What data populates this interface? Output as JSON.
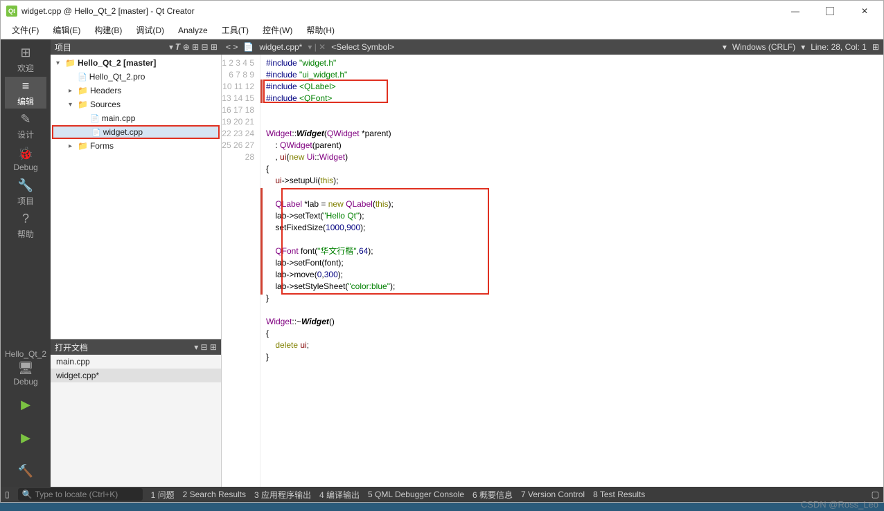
{
  "titlebar": {
    "app_icon": "Qt",
    "title": "widget.cpp @ Hello_Qt_2 [master] - Qt Creator"
  },
  "menubar": [
    "文件(F)",
    "编辑(E)",
    "构建(B)",
    "调试(D)",
    "Analyze",
    "工具(T)",
    "控件(W)",
    "帮助(H)"
  ],
  "leftbar": {
    "items": [
      {
        "icon": "⊞",
        "label": "欢迎"
      },
      {
        "icon": "≡",
        "label": "编辑",
        "active": true
      },
      {
        "icon": "✎",
        "label": "设计"
      },
      {
        "icon": "🐞",
        "label": "Debug"
      },
      {
        "icon": "🔧",
        "label": "项目"
      },
      {
        "icon": "?",
        "label": "帮助"
      }
    ],
    "target": {
      "name": "Hello_Qt_2",
      "mode": "Debug"
    }
  },
  "project_panel": {
    "title": "项目",
    "tree": [
      {
        "depth": 0,
        "caret": "▾",
        "icon": "folder",
        "label": "Hello_Qt_2 [master]",
        "bold": true
      },
      {
        "depth": 1,
        "caret": "",
        "icon": "file",
        "label": "Hello_Qt_2.pro"
      },
      {
        "depth": 1,
        "caret": "▸",
        "icon": "folder",
        "label": "Headers"
      },
      {
        "depth": 1,
        "caret": "▾",
        "icon": "folder",
        "label": "Sources"
      },
      {
        "depth": 2,
        "caret": "",
        "icon": "file",
        "label": "main.cpp"
      },
      {
        "depth": 2,
        "caret": "",
        "icon": "file",
        "label": "widget.cpp",
        "selected": true
      },
      {
        "depth": 1,
        "caret": "▸",
        "icon": "folder",
        "label": "Forms"
      }
    ]
  },
  "open_docs": {
    "title": "打开文档",
    "items": [
      {
        "name": "main.cpp"
      },
      {
        "name": "widget.cpp*",
        "active": true
      }
    ]
  },
  "editor": {
    "toolbar": {
      "nav": "< >",
      "file": "widget.cpp*",
      "symbol": "<Select Symbol>",
      "encoding": "Windows (CRLF)",
      "pos": "Line: 28, Col: 1"
    }
  },
  "code_lines": 28,
  "statusbar": {
    "locator_placeholder": "Type to locate (Ctrl+K)",
    "items": [
      "1 问题",
      "2 Search Results",
      "3 应用程序输出",
      "4 编译输出",
      "5 QML Debugger Console",
      "6 概要信息",
      "7 Version Control",
      "8 Test Results"
    ]
  },
  "watermark": "CSDN @Ross_Leo"
}
